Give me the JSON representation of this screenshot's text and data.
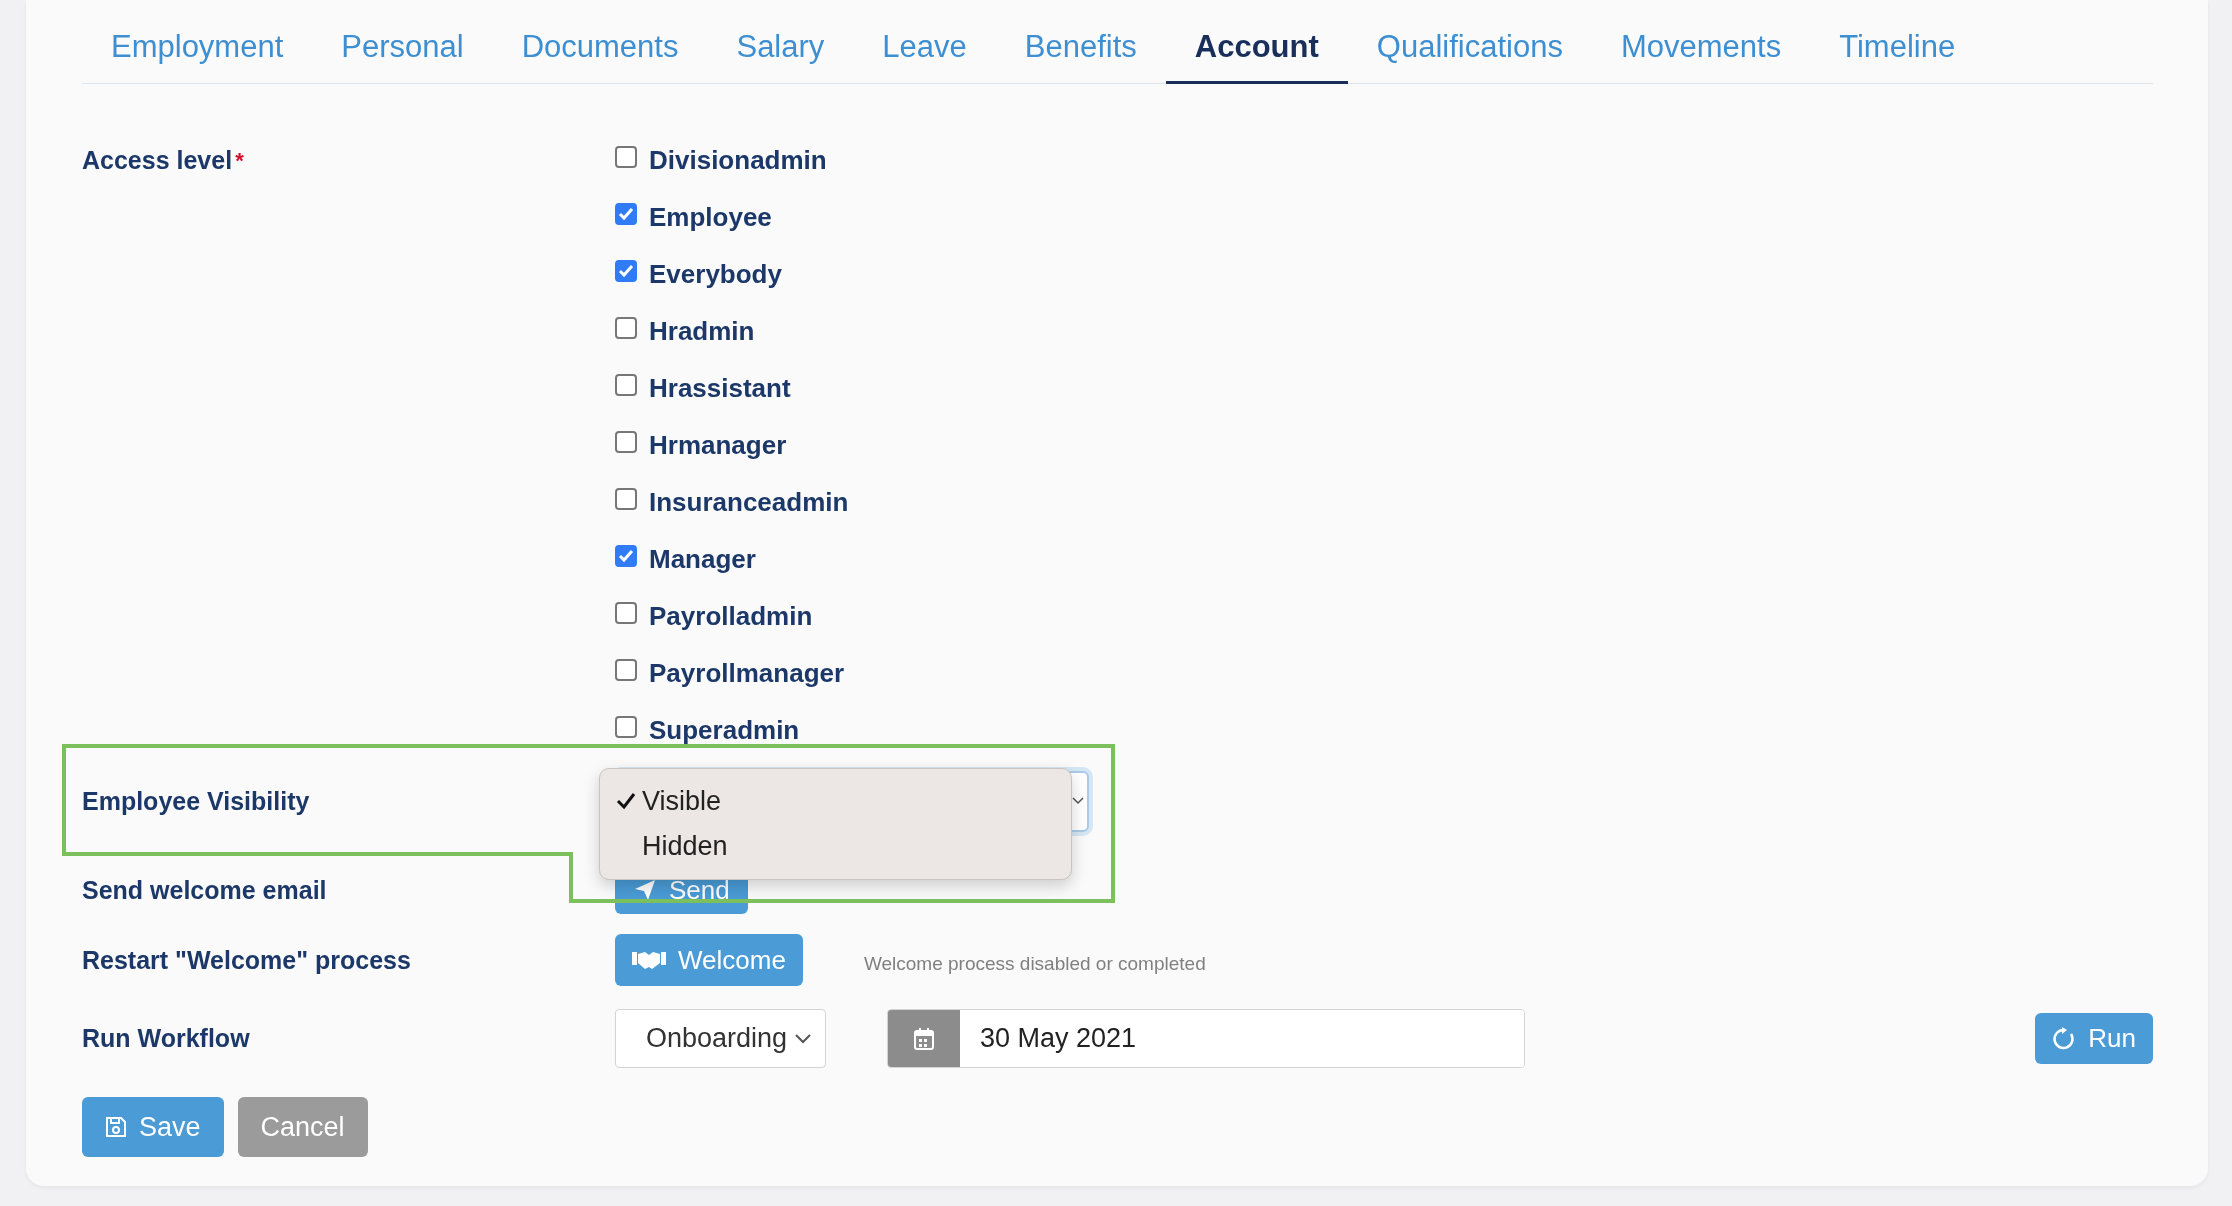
{
  "tabs": [
    {
      "label": "Employment",
      "selected": false
    },
    {
      "label": "Personal",
      "selected": false
    },
    {
      "label": "Documents",
      "selected": false
    },
    {
      "label": "Salary",
      "selected": false
    },
    {
      "label": "Leave",
      "selected": false
    },
    {
      "label": "Benefits",
      "selected": false
    },
    {
      "label": "Account",
      "selected": true
    },
    {
      "label": "Qualifications",
      "selected": false
    },
    {
      "label": "Movements",
      "selected": false
    },
    {
      "label": "Timeline",
      "selected": false
    }
  ],
  "access_level": {
    "label": "Access level",
    "required_mark": "*",
    "roles": [
      {
        "label": "Divisionadmin",
        "checked": false
      },
      {
        "label": "Employee",
        "checked": true
      },
      {
        "label": "Everybody",
        "checked": true
      },
      {
        "label": "Hradmin",
        "checked": false
      },
      {
        "label": "Hrassistant",
        "checked": false
      },
      {
        "label": "Hrmanager",
        "checked": false
      },
      {
        "label": "Insuranceadmin",
        "checked": false
      },
      {
        "label": "Manager",
        "checked": true
      },
      {
        "label": "Payrolladmin",
        "checked": false
      },
      {
        "label": "Payrollmanager",
        "checked": false
      },
      {
        "label": "Superadmin",
        "checked": false
      }
    ]
  },
  "employee_visibility": {
    "label": "Employee Visibility",
    "dropdown_options": [
      {
        "label": "Visible",
        "selected": true
      },
      {
        "label": "Hidden",
        "selected": false
      }
    ]
  },
  "welcome_email": {
    "label": "Send welcome email",
    "button": "Send"
  },
  "welcome_process": {
    "label": "Restart \"Welcome\" process",
    "button": "Welcome",
    "note": "Welcome process disabled or completed"
  },
  "run_workflow": {
    "label": "Run Workflow",
    "workflow": "Onboarding",
    "date": "30 May 2021",
    "button": "Run"
  },
  "actions": [
    {
      "label": "Save",
      "kind": "primary"
    },
    {
      "label": "Cancel",
      "kind": "secondary"
    }
  ]
}
